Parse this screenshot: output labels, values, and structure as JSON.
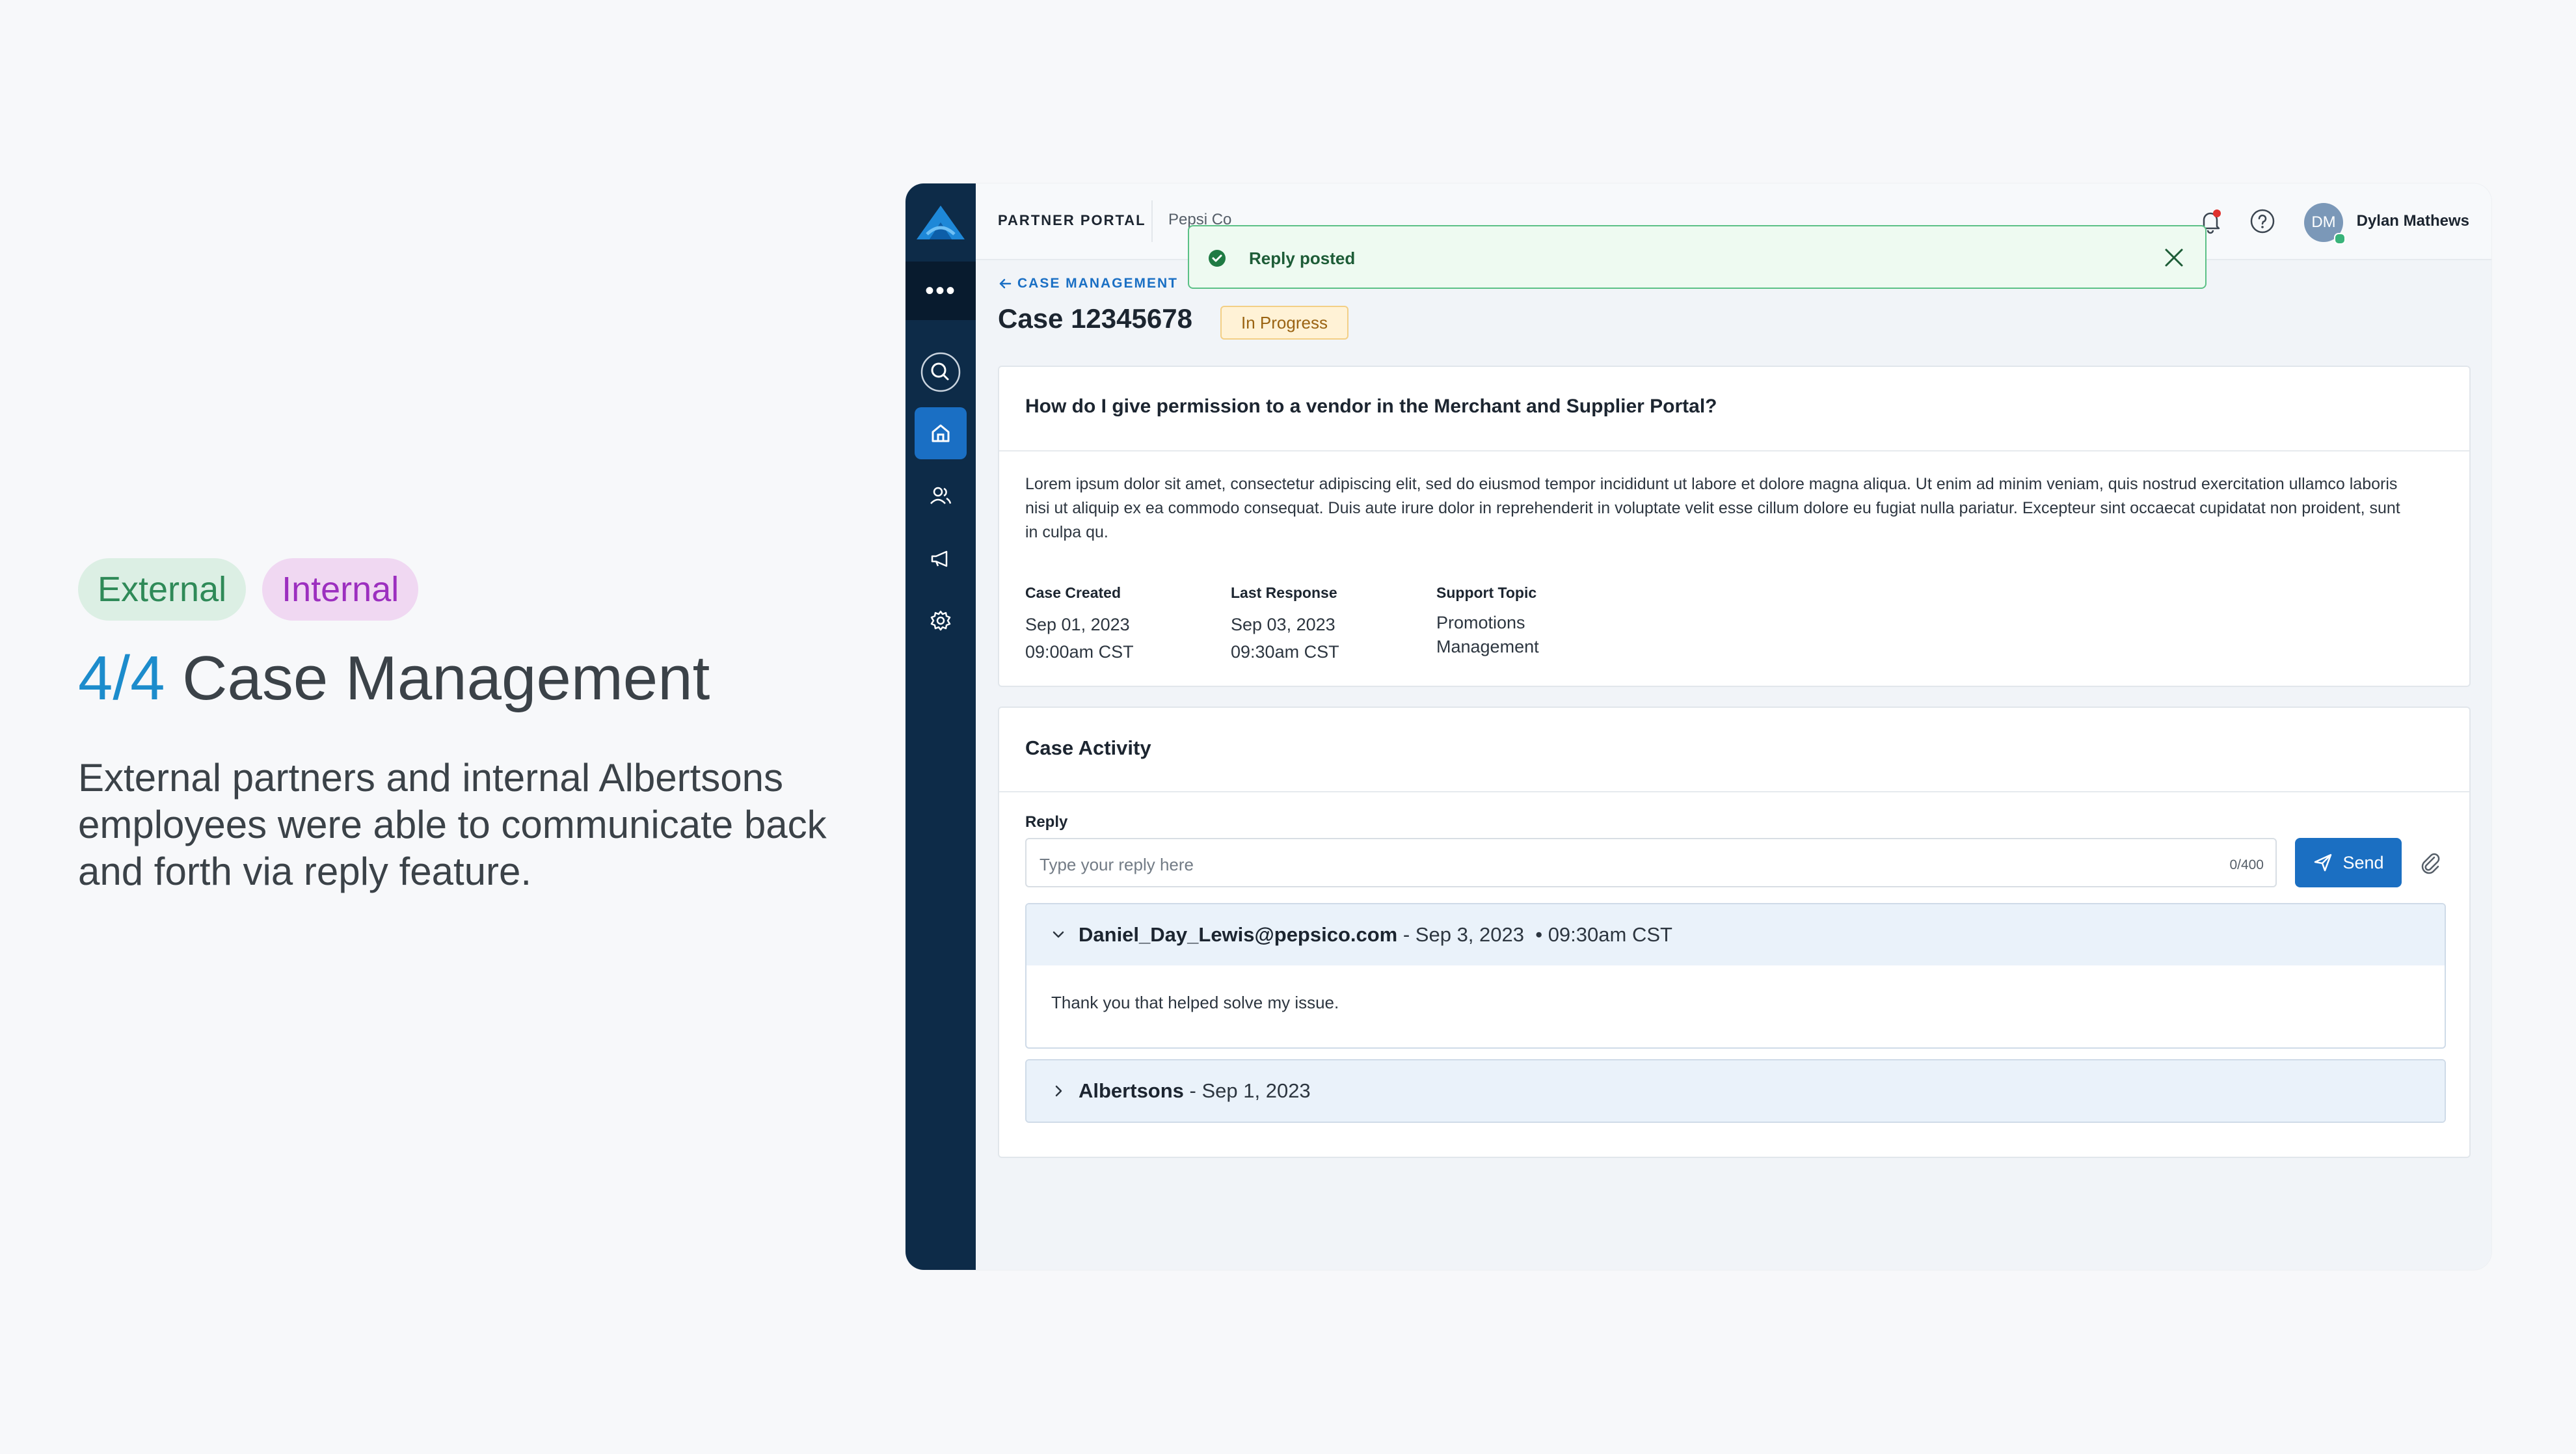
{
  "slide": {
    "tag_external": "External",
    "tag_internal": "Internal",
    "title_number": "4/4",
    "title_text": "Case Management",
    "description": "External partners and internal Albertsons employees were able to communicate back and forth via reply feature."
  },
  "header": {
    "portal_name": "PARTNER PORTAL",
    "organization": "Pepsi Co",
    "user_initials": "DM",
    "user_name": "Dylan Mathews"
  },
  "toast": {
    "message": "Reply posted"
  },
  "breadcrumb": {
    "label": "CASE MANAGEMENT"
  },
  "case": {
    "title": "Case 12345678",
    "status": "In Progress",
    "question": "How do I give permission to a vendor in the Merchant and Supplier Portal?",
    "body": "Lorem ipsum dolor sit amet, consectetur adipiscing elit, sed do eiusmod tempor incididunt ut labore et dolore magna aliqua. Ut enim ad minim veniam, quis nostrud exercitation ullamco laboris nisi ut aliquip ex ea commodo consequat. Duis aute irure dolor in reprehenderit in voluptate velit esse cillum dolore eu fugiat nulla pariatur. Excepteur sint occaecat cupidatat non proident, sunt in culpa qu.",
    "meta": [
      {
        "label": "Case Created",
        "line1": "Sep 01, 2023",
        "line2": "09:00am CST"
      },
      {
        "label": "Last Response",
        "line1": "Sep 03, 2023",
        "line2": "09:30am CST"
      },
      {
        "label": "Support Topic",
        "line1": "Promotions",
        "line2": "Management"
      }
    ]
  },
  "activity": {
    "title": "Case Activity",
    "reply_label": "Reply",
    "reply_placeholder": "Type your reply here",
    "counter": "0/400",
    "send_label": "Send",
    "threads": [
      {
        "author": "Daniel_Day_Lewis@pepsico.com",
        "meta": " - Sep 3, 2023  • 09:30am CST",
        "message": "Thank you that helped solve my issue.",
        "expanded": true
      },
      {
        "author": "Albertsons",
        "meta": " - Sep 1, 2023",
        "expanded": false
      }
    ]
  },
  "colors": {
    "navy": "#0d2b48",
    "accent_blue": "#1a6fc4",
    "success_green": "#5bc086",
    "status_bg": "#fff2d6"
  },
  "icons": [
    "app-logo-icon",
    "more-dots-icon",
    "search-icon",
    "home-icon",
    "users-icon",
    "megaphone-icon",
    "gear-icon",
    "bell-icon",
    "help-icon",
    "check-circle-icon",
    "close-icon",
    "arrow-left-icon",
    "send-icon",
    "paperclip-icon",
    "chevron-down-icon",
    "chevron-right-icon"
  ]
}
